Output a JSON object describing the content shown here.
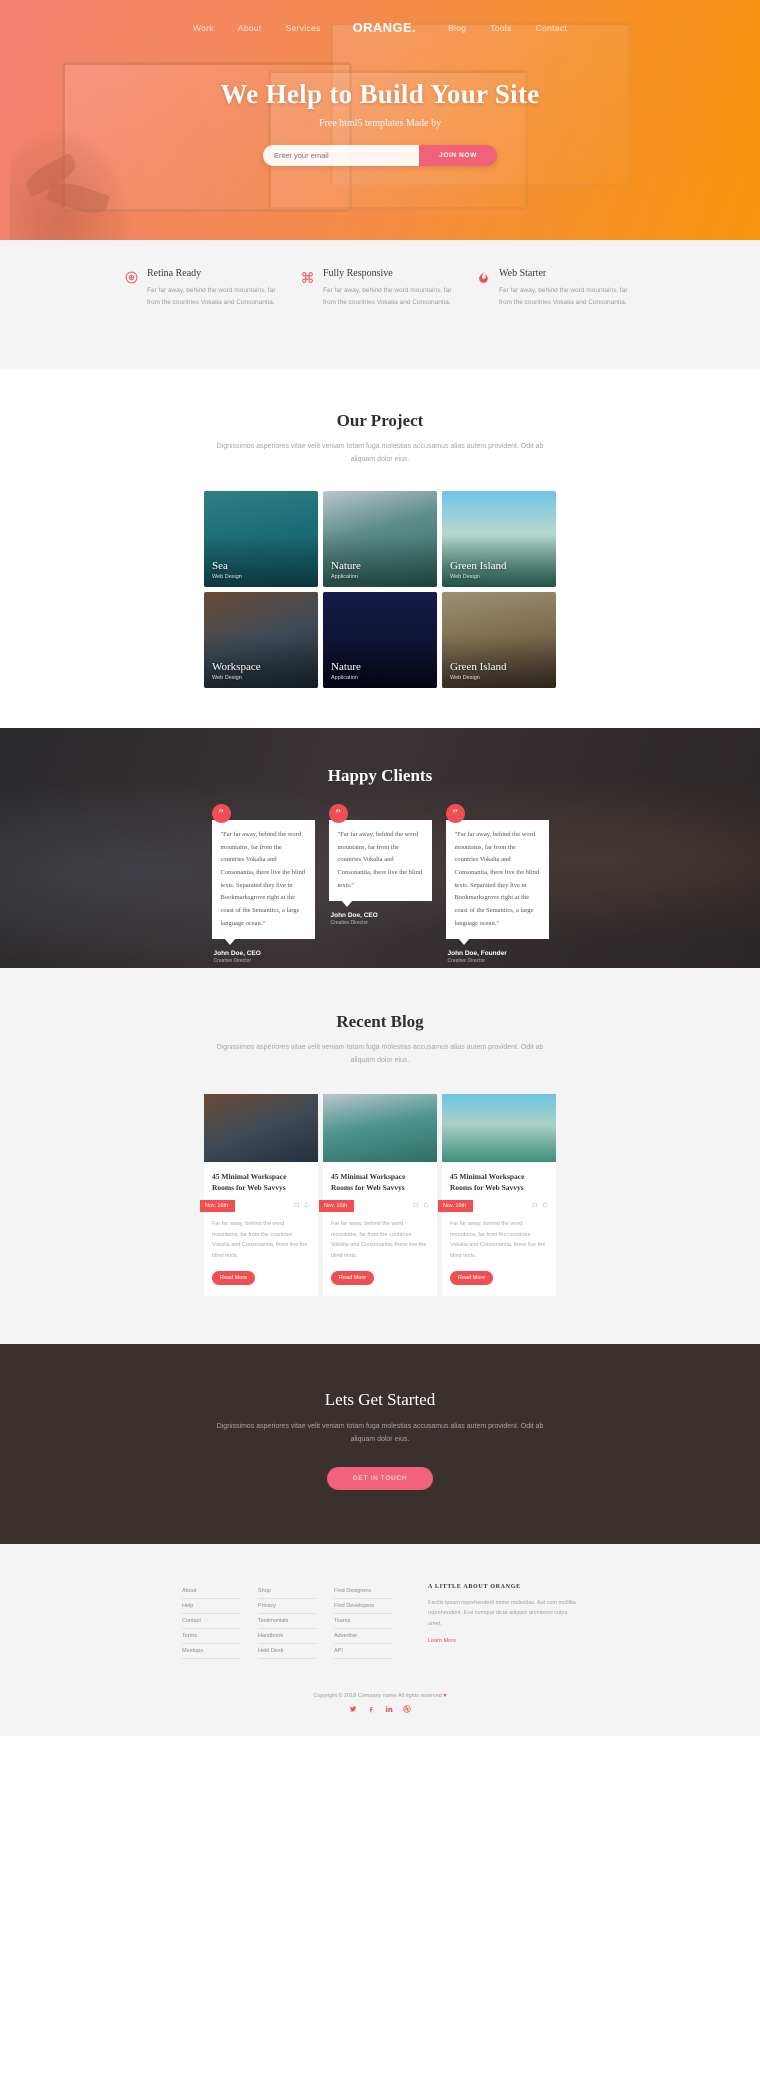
{
  "nav": {
    "brand": "ORANGE.",
    "left": [
      {
        "label": "Work"
      },
      {
        "label": "About"
      },
      {
        "label": "Services"
      }
    ],
    "right": [
      {
        "label": "Blog"
      },
      {
        "label": "Tools"
      },
      {
        "label": "Contact"
      }
    ]
  },
  "hero": {
    "title": "We Help to Build Your Site",
    "subtitle": "Free html5 templates Made by",
    "email_placeholder": "Enter your email",
    "email_value": "",
    "cta_label": "JOIN NOW"
  },
  "features": [
    {
      "icon": "eye-icon",
      "title": "Retina Ready",
      "text": "Far far away, behind the word mountains, far from the countries Vokalia and Consonantia."
    },
    {
      "icon": "command-icon",
      "title": "Fully Responsive",
      "text": "Far far away, behind the word mountains, far from the countries Vokalia and Consonantia."
    },
    {
      "icon": "flame-icon",
      "title": "Web Starter",
      "text": "Far far away, behind the word mountains, far from the countries Vokalia and Consonantia."
    }
  ],
  "projects": {
    "title": "Our Project",
    "subtitle": "Dignissimos asperiores vitae velit veniam totam fuga molestias accusamus alias autem provident. Odit ab aliquam dolor eius.",
    "items": [
      {
        "title": "Sea",
        "category": "Web Design",
        "theme": "t-sea"
      },
      {
        "title": "Nature",
        "category": "Application",
        "theme": "t-nature"
      },
      {
        "title": "Green Island",
        "category": "Web Design",
        "theme": "t-green"
      },
      {
        "title": "Workspace",
        "category": "Web Design",
        "theme": "t-work"
      },
      {
        "title": "Nature",
        "category": "Application",
        "theme": "t-dark"
      },
      {
        "title": "Green Island",
        "category": "Web Design",
        "theme": "t-stone"
      }
    ]
  },
  "clients": {
    "title": "Happy Clients",
    "testimonials": [
      {
        "quote": "\"Far far away, behind the word mountains, far from the countries Vokalia and Consonantia, there live the blind texts. Separated they live in Bookmarksgrove right at the coast of the Semantics, a large language ocean.\"",
        "name": "John Doe, CEO",
        "role": "Creative Director"
      },
      {
        "quote": "\"Far far away, behind the word mountains, far from the countries Vokalia and Consonantia, there live the blind texts.\"",
        "name": "John Doe, CEO",
        "role": "Creative Director"
      },
      {
        "quote": "\"Far far away, behind the word mountains, far from the countries Vokalia and Consonantia, there live the blind texts. Separated they live in Bookmarksgrove right at the coast of the Semantics, a large language ocean.\"",
        "name": "John Doe, Founder",
        "role": "Creative Director"
      }
    ],
    "quote_glyph": "”"
  },
  "blog": {
    "title": "Recent Blog",
    "subtitle": "Dignissimos asperiores vitae velit veniam totam fuga molestias accusamus alias autem provident. Odit ab aliquam dolor eius.",
    "posts": [
      {
        "title": "45 Minimal Workspace Rooms for Web Savvys",
        "date": "Nov. 16th",
        "likes": "21",
        "comments": "2",
        "excerpt": "Far far away, behind the word mountains, far from the countries Vokalia and Consonantia, there live the blind texts.",
        "more_label": "Read More",
        "theme": "b1"
      },
      {
        "title": "45 Minimal Workspace Rooms for Web Savvys",
        "date": "Nov. 16th",
        "likes": "21",
        "comments": "2",
        "excerpt": "Far far away, behind the word mountains, far from the countries Vokalia and Consonantia, there live the blind texts.",
        "more_label": "Read More",
        "theme": "b2"
      },
      {
        "title": "45 Minimal Workspace Rooms for Web Savvys",
        "date": "Nov. 16th",
        "likes": "21",
        "comments": "2",
        "excerpt": "Far far away, behind the word mountains, far from the countries Vokalia and Consonantia, there live the blind texts.",
        "more_label": "Read More",
        "theme": "b3"
      }
    ]
  },
  "cta": {
    "title": "Lets Get Started",
    "text": "Dignissimos asperiores vitae velit veniam totam fuga molestias accusamus alias autem provident. Odit ab aliquam dolor eius.",
    "button_label": "GET IN TOUCH"
  },
  "footer": {
    "columns": [
      {
        "items": [
          "About",
          "Help",
          "Contact",
          "Terms",
          "Meetups"
        ]
      },
      {
        "items": [
          "Shop",
          "Privacy",
          "Testimonials",
          "Handbook",
          "Held Desk"
        ]
      },
      {
        "items": [
          "Find Designers",
          "Find Developers",
          "Teams",
          "Advertise",
          "API"
        ]
      }
    ],
    "about": {
      "heading": "A LITTLE ABOUT ORANGE",
      "text": "Facilis ipsam reprehenderit nemo molestias. Aut cum mollitia reprehenderit. Eos cumque dicta adipisci architecto culpa amet.",
      "link": "Learn More"
    },
    "copyright": "Copyright © 2018 Company name All rights reserved",
    "heart": "♥",
    "social": [
      "twitter-icon",
      "facebook-icon",
      "linkedin-icon",
      "dribbble-icon"
    ]
  },
  "colors": {
    "accent": "#ef4f53",
    "pink": "#f2617a",
    "orange": "#f89234",
    "dark": "#3a302d"
  }
}
